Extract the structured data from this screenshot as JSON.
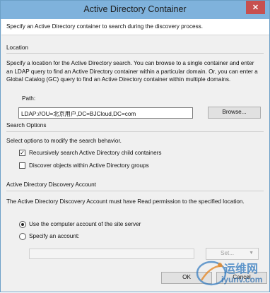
{
  "window": {
    "title": "Active Directory Container",
    "close_icon": "✕"
  },
  "intro": "Specify an Active Directory container to search during the discovery process.",
  "location": {
    "heading": "Location",
    "description": "Specify a location for the Active Directory search. You can browse to a single container and enter an LDAP query to find an Active Directory container within a particular domain. Or, you can enter a Global Catalog (GC) query to find an Active Directory container within multiple domains.",
    "path_label": "Path:",
    "path_value": "LDAP://OU=北京用户,DC=BJCloud,DC=com",
    "browse_label": "Browse..."
  },
  "search_options": {
    "heading": "Search Options",
    "description": "Select options to modify the search behavior.",
    "options": [
      {
        "label": "Recursively search Active Directory child containers",
        "checked": true
      },
      {
        "label": "Discover objects within Active Directory groups",
        "checked": false
      }
    ]
  },
  "account": {
    "heading": "Active Directory Discovery Account",
    "description": "The Active Directory Discovery Account must have Read permission to the specified location.",
    "radio_computer": "Use the computer account of the site server",
    "radio_specify": "Specify an account:",
    "set_label": "Set...",
    "selected": "computer"
  },
  "buttons": {
    "ok": "OK",
    "cancel": "Cancel"
  },
  "watermark": {
    "cn": "运维网",
    "url": "iyunv.com"
  }
}
